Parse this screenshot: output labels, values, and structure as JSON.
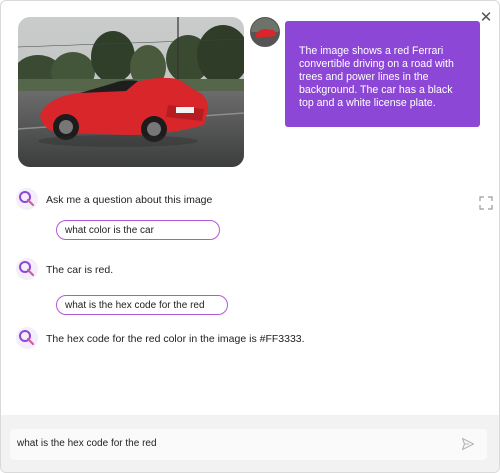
{
  "dialog": {
    "close_icon": "close-icon",
    "expand_icon": "expand-icon"
  },
  "image_caption": "The image shows a red Ferrari convertible driving on a road with trees and power lines in the background. The car has a black top and a white license plate.",
  "conversation": [
    {
      "role": "bot",
      "text": "Ask me a question about this image"
    },
    {
      "role": "user",
      "text": "what color is the car"
    },
    {
      "role": "bot",
      "text": "The car is red."
    },
    {
      "role": "user",
      "text": "what is the hex code for the red"
    },
    {
      "role": "bot",
      "text": "The hex code for the red color in the image is #FF3333."
    }
  ],
  "input": {
    "value": "what is the hex code for the red",
    "send_icon": "send-icon"
  },
  "colors": {
    "accent": "#8c47d6",
    "pill_border": "#b15ad8",
    "car_red": "#FF3333"
  }
}
